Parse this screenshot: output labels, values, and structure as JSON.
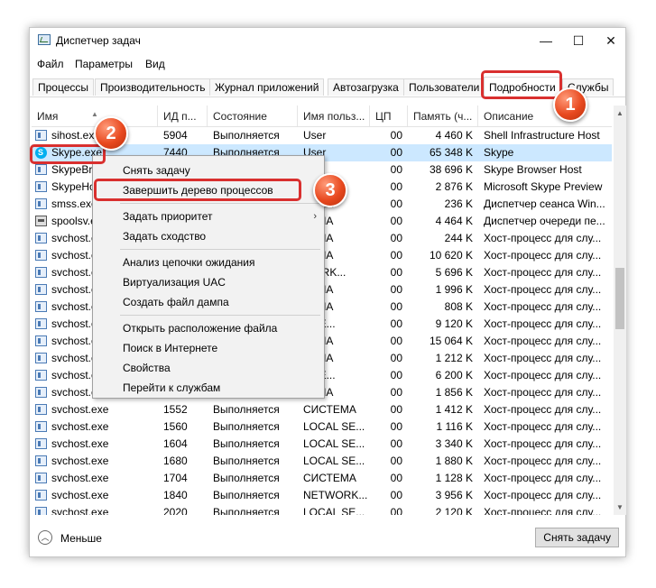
{
  "window": {
    "title": "Диспетчер задач",
    "minimize": "—",
    "maximize": "☐",
    "close": "✕"
  },
  "menu": {
    "file": "Файл",
    "options": "Параметры",
    "view": "Вид"
  },
  "tabs": [
    "Процессы",
    "Производительность",
    "Журнал приложений",
    "Автозагрузка",
    "Пользователи",
    "Подробности",
    "Службы"
  ],
  "columns": [
    "Имя",
    "ИД п...",
    "Состояние",
    "Имя польз...",
    "ЦП",
    "Память (ч...",
    "Описание"
  ],
  "rows": [
    {
      "icon": "app",
      "name": "sihost.exe",
      "pid": "5904",
      "status": "Выполняется",
      "user": "User",
      "cpu": "00",
      "mem": "4 460 K",
      "desc": "Shell Infrastructure Host"
    },
    {
      "icon": "skype",
      "name": "Skype.exe",
      "pid": "7440",
      "status": "Выполняется",
      "user": "User",
      "cpu": "00",
      "mem": "65 348 K",
      "desc": "Skype"
    },
    {
      "icon": "app",
      "name": "SkypeBro",
      "pid": "",
      "status": "",
      "user": "",
      "cpu": "00",
      "mem": "38 696 K",
      "desc": "Skype Browser Host"
    },
    {
      "icon": "app",
      "name": "SkypeHo",
      "pid": "",
      "status": "",
      "user": "",
      "cpu": "00",
      "mem": "2 876 K",
      "desc": "Microsoft Skype Preview"
    },
    {
      "icon": "app",
      "name": "smss.exe",
      "pid": "",
      "status": "",
      "user": "ТЕМА",
      "cpu": "00",
      "mem": "236 K",
      "desc": "Диспетчер сеанса Win..."
    },
    {
      "icon": "printer",
      "name": "spoolsv.e",
      "pid": "",
      "status": "",
      "user": "ТЕМА",
      "cpu": "00",
      "mem": "4 464 K",
      "desc": "Диспетчер очереди пе..."
    },
    {
      "icon": "app",
      "name": "svchost.e",
      "pid": "",
      "status": "",
      "user": "ТЕМА",
      "cpu": "00",
      "mem": "244 K",
      "desc": "Хост-процесс для слу..."
    },
    {
      "icon": "app",
      "name": "svchost.e",
      "pid": "",
      "status": "",
      "user": "ТЕМА",
      "cpu": "00",
      "mem": "10 620 K",
      "desc": "Хост-процесс для слу..."
    },
    {
      "icon": "app",
      "name": "svchost.e",
      "pid": "",
      "status": "",
      "user": "WORK...",
      "cpu": "00",
      "mem": "5 696 K",
      "desc": "Хост-процесс для слу..."
    },
    {
      "icon": "app",
      "name": "svchost.e",
      "pid": "",
      "status": "",
      "user": "ТЕМА",
      "cpu": "00",
      "mem": "1 996 K",
      "desc": "Хост-процесс для слу..."
    },
    {
      "icon": "app",
      "name": "svchost.e",
      "pid": "",
      "status": "",
      "user": "ТЕМА",
      "cpu": "00",
      "mem": "808 K",
      "desc": "Хост-процесс для слу..."
    },
    {
      "icon": "app",
      "name": "svchost.e",
      "pid": "",
      "status": "",
      "user": "L SE...",
      "cpu": "00",
      "mem": "9 120 K",
      "desc": "Хост-процесс для слу..."
    },
    {
      "icon": "app",
      "name": "svchost.e",
      "pid": "",
      "status": "",
      "user": "ТЕМА",
      "cpu": "00",
      "mem": "15 064 K",
      "desc": "Хост-процесс для слу..."
    },
    {
      "icon": "app",
      "name": "svchost.e",
      "pid": "",
      "status": "",
      "user": "ТЕМА",
      "cpu": "00",
      "mem": "1 212 K",
      "desc": "Хост-процесс для слу..."
    },
    {
      "icon": "app",
      "name": "svchost.e",
      "pid": "",
      "status": "",
      "user": "L SE...",
      "cpu": "00",
      "mem": "6 200 K",
      "desc": "Хост-процесс для слу..."
    },
    {
      "icon": "app",
      "name": "svchost.e",
      "pid": "",
      "status": "",
      "user": "ТЕМА",
      "cpu": "00",
      "mem": "1 856 K",
      "desc": "Хост-процесс для слу..."
    },
    {
      "icon": "app",
      "name": "svchost.exe",
      "pid": "1552",
      "status": "Выполняется",
      "user": "СИСТЕМА",
      "cpu": "00",
      "mem": "1 412 K",
      "desc": "Хост-процесс для слу..."
    },
    {
      "icon": "app",
      "name": "svchost.exe",
      "pid": "1560",
      "status": "Выполняется",
      "user": "LOCAL SE...",
      "cpu": "00",
      "mem": "1 116 K",
      "desc": "Хост-процесс для слу..."
    },
    {
      "icon": "app",
      "name": "svchost.exe",
      "pid": "1604",
      "status": "Выполняется",
      "user": "LOCAL SE...",
      "cpu": "00",
      "mem": "3 340 K",
      "desc": "Хост-процесс для слу..."
    },
    {
      "icon": "app",
      "name": "svchost.exe",
      "pid": "1680",
      "status": "Выполняется",
      "user": "LOCAL SE...",
      "cpu": "00",
      "mem": "1 880 K",
      "desc": "Хост-процесс для слу..."
    },
    {
      "icon": "app",
      "name": "svchost.exe",
      "pid": "1704",
      "status": "Выполняется",
      "user": "СИСТЕМА",
      "cpu": "00",
      "mem": "1 128 K",
      "desc": "Хост-процесс для слу..."
    },
    {
      "icon": "app",
      "name": "svchost.exe",
      "pid": "1840",
      "status": "Выполняется",
      "user": "NETWORK...",
      "cpu": "00",
      "mem": "3 956 K",
      "desc": "Хост-процесс для слу..."
    },
    {
      "icon": "app",
      "name": "svchost.exe",
      "pid": "2020",
      "status": "Выполняется",
      "user": "LOCAL SE...",
      "cpu": "00",
      "mem": "2 120 K",
      "desc": "Хост-процесс для слу..."
    }
  ],
  "context_menu": {
    "items": [
      "Снять задачу",
      "Завершить дерево процессов",
      "Задать приоритет",
      "Задать сходство",
      "Анализ цепочки ожидания",
      "Виртуализация UAC",
      "Создать файл дампа",
      "Открыть расположение файла",
      "Поиск в Интернете",
      "Свойства",
      "Перейти к службам"
    ],
    "submenu_arrow": "›"
  },
  "footer": {
    "less_label": "Меньше",
    "end_task_button": "Снять задачу"
  },
  "annotations": {
    "badge1": "1",
    "badge2": "2",
    "badge3": "3"
  },
  "colors": {
    "selection": "#cce8ff",
    "highlight": "#d9302f"
  }
}
